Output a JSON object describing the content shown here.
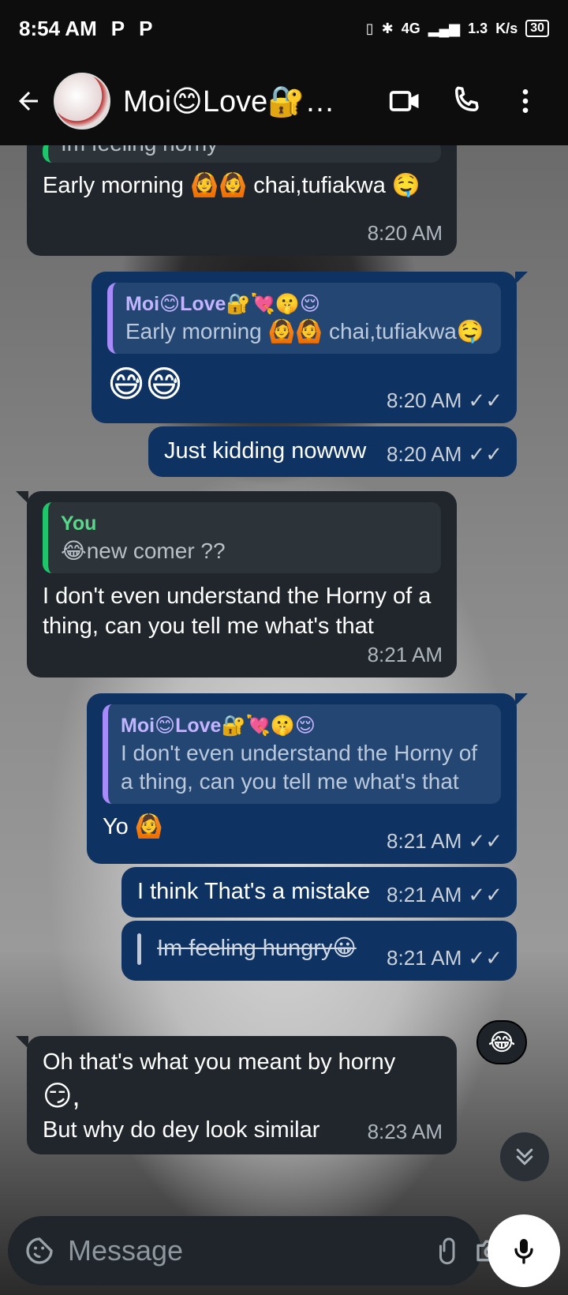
{
  "status": {
    "time": "8:54 AM",
    "app_badges": [
      "P",
      "P"
    ],
    "network": "4G",
    "speed_value": "1.3",
    "speed_unit": "K/s",
    "battery": "30"
  },
  "header": {
    "contact_name": "Moi😊Love🔐…",
    "avatar_icon": "profile-avatar",
    "back_icon": "arrow-left-icon",
    "video_icon": "video-call-icon",
    "call_icon": "phone-icon",
    "menu_icon": "more-vert-icon"
  },
  "messages": [
    {
      "direction": "in",
      "partial_quote": "Im feeling horny",
      "text": "Early morning 🙆🙆 chai,tufiakwa 🤤",
      "time": "8:20 AM"
    },
    {
      "direction": "out",
      "quote_author": "Moi😊Love🔐💘🤫😌",
      "quote_text": "Early morning 🙆🙆 chai,tufiakwa🤤",
      "text": "😅😅",
      "time": "8:20 AM"
    },
    {
      "direction": "out",
      "text": "Just kidding nowww",
      "time": "8:20 AM"
    },
    {
      "direction": "in",
      "quote_author": "You",
      "quote_text": "😂new comer ??",
      "text": "I don't even understand the Horny of a thing, can you tell me what's that",
      "time": "8:21 AM"
    },
    {
      "direction": "out",
      "quote_author": "Moi😊Love🔐💘🤫😌",
      "quote_text": "I don't even understand the Horny of a thing, can you tell me what's that",
      "text": "Yo 🙆",
      "time": "8:21 AM"
    },
    {
      "direction": "out",
      "text": "I think That's a mistake",
      "time": "8:21 AM"
    },
    {
      "direction": "out",
      "text": "Im feeling hungry😀",
      "time": "8:21 AM",
      "strikethrough": true
    },
    {
      "direction": "in",
      "text_line1": "Oh that's what you meant by horny",
      "text_line2": "😏,",
      "text_line3": "But why do dey look similar",
      "time": "8:23 AM"
    }
  ],
  "reaction": "😂",
  "composer": {
    "placeholder": "Message",
    "sticker_icon": "sticker-icon",
    "attach_icon": "paperclip-icon",
    "camera_icon": "camera-icon",
    "mic_icon": "mic-icon"
  }
}
